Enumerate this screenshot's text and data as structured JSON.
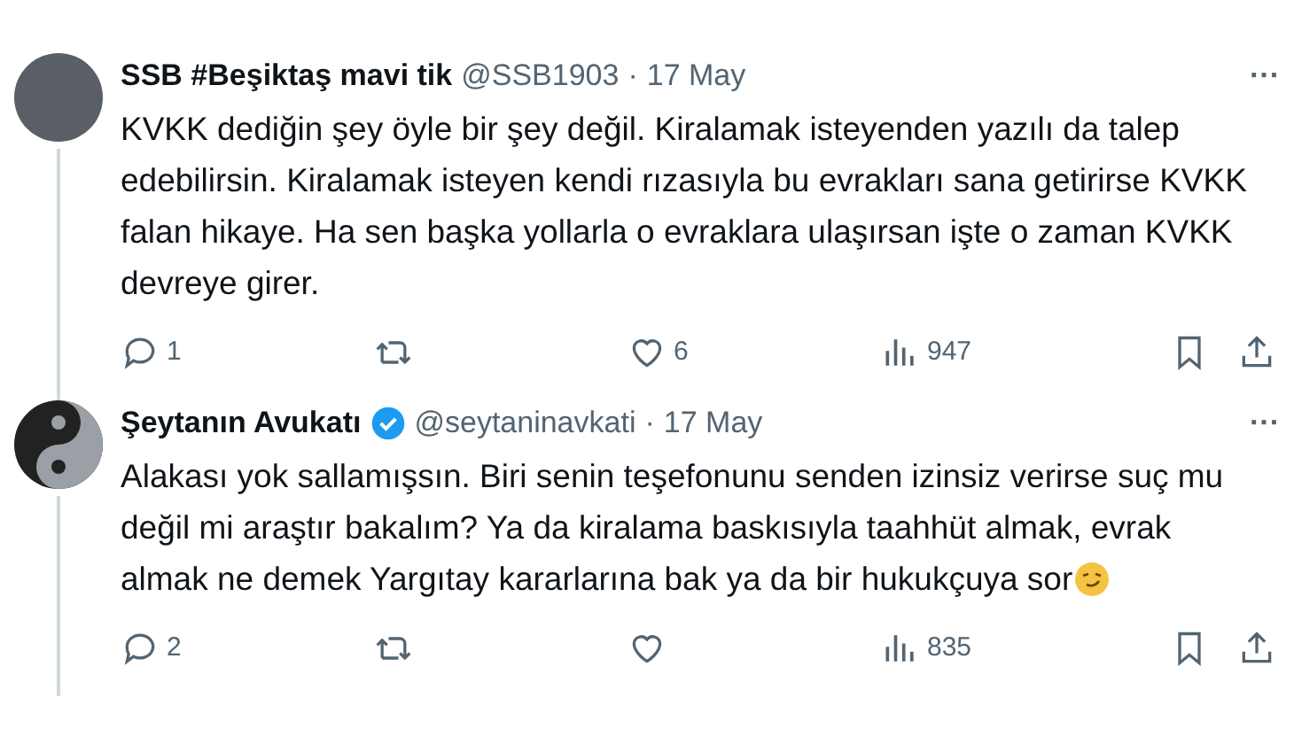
{
  "tweets": [
    {
      "name": "SSB #Beşiktaş mavi tik",
      "verified": false,
      "handle": "@SSB1903",
      "separator": "·",
      "date": "17 May",
      "more": "···",
      "text": "KVKK dediğin şey öyle bir şey değil. Kiralamak isteyenden yazılı da talep edebilirsin. Kiralamak isteyen kendi rızasıyla bu evrakları sana getirirse KVKK falan hikaye. Ha sen başka yollarla o evraklara ulaşırsan işte o zaman KVKK devreye girer.",
      "emoji": false,
      "replies": "1",
      "likes": "6",
      "views": "947"
    },
    {
      "name": "Şeytanın Avukatı",
      "verified": true,
      "handle": "@seytaninavkati",
      "separator": "·",
      "date": "17 May",
      "more": "···",
      "text": "Alakası yok sallamışsın. Biri senin teşefonunu senden izinsiz verirse suç mu değil mi araştır bakalım? Ya da kiralama baskısıyla taahhüt almak, evrak almak ne demek Yargıtay kararlarına bak ya da bir hukukçuya sor",
      "emoji": true,
      "replies": "2",
      "views": "835"
    }
  ]
}
